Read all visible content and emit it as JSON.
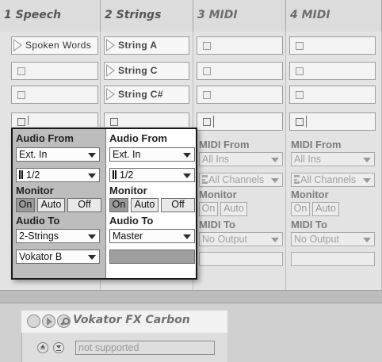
{
  "tracks": [
    {
      "title": "1 Speech"
    },
    {
      "title": "2 Strings"
    },
    {
      "title": "3 MIDI"
    },
    {
      "title": "4 MIDI"
    }
  ],
  "clips": {
    "speech_row1": "Spoken Words",
    "strings_row1": "String A",
    "strings_row2": "String C",
    "strings_row3": "String C#"
  },
  "io": {
    "audio_from_label": "Audio From",
    "midi_from_label": "MIDI From",
    "monitor_label": "Monitor",
    "audio_to_label": "Audio To",
    "midi_to_label": "MIDI To",
    "on_label": "On",
    "auto_label": "Auto",
    "off_label": "Off",
    "speech": {
      "input_type": "Ext. In",
      "input_channel": "1/2",
      "output_type": "2-Strings",
      "output_channel": "Vokator B"
    },
    "strings": {
      "input_type": "Ext. In",
      "input_channel": "1/2",
      "output_type": "Master",
      "output_channel": ""
    },
    "midi3": {
      "input_type": "All Ins",
      "input_channel": "All Channels",
      "output_type": "No Output",
      "output_channel": ""
    },
    "midi4": {
      "input_type": "All Ins",
      "input_channel": "All Channels",
      "output_type": "No Output",
      "output_channel": ""
    }
  },
  "device": {
    "name": "Vokator FX Carbon",
    "status": "not supported"
  },
  "colors": {
    "popup_border": "#1a1a1a",
    "background": "#c8c8c8"
  }
}
